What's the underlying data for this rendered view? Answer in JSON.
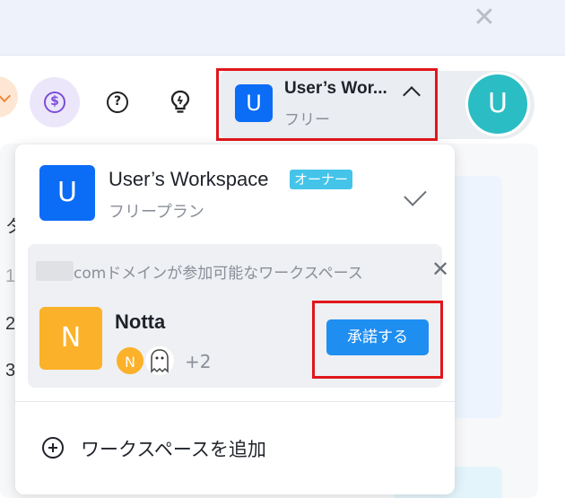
{
  "banner": {
    "close_glyph": "✕"
  },
  "background": {
    "row_text": [
      "タ",
      "1",
      "2",
      "3"
    ]
  },
  "toolbar": {
    "billing_icon": "dollar-circle-icon",
    "billing_glyph": "$",
    "help_icon": "question-circle-icon",
    "help_glyph": "?",
    "tips_icon": "lightbulb-icon"
  },
  "workspace_switcher": {
    "badge_letter": "U",
    "name": "User’s Wor...",
    "plan": "フリー",
    "chevron_icon": "chevron-up-icon"
  },
  "user_avatar": {
    "letter": "U",
    "color": "#2bbdc4"
  },
  "dropdown": {
    "current_workspace": {
      "badge_letter": "U",
      "title": "User’s Workspace",
      "role_tag": "オーナー",
      "plan": "フリープラン",
      "check_icon": "checkmark-icon"
    },
    "invite": {
      "title": "comドメインが参加可能なワークスペース",
      "close_glyph": "✕",
      "workspace_badge_letter": "N",
      "workspace_name": "Notta",
      "member_avatar_letter": "N",
      "member_more": "+2",
      "accept_label": "承諾する",
      "accept_color": "#1f8ef1"
    },
    "add_workspace_label": "ワークスペースを追加"
  },
  "colors": {
    "brand_blue": "#0b6cf6",
    "notta_orange": "#fbb129",
    "highlight_red": "#e0161b"
  }
}
